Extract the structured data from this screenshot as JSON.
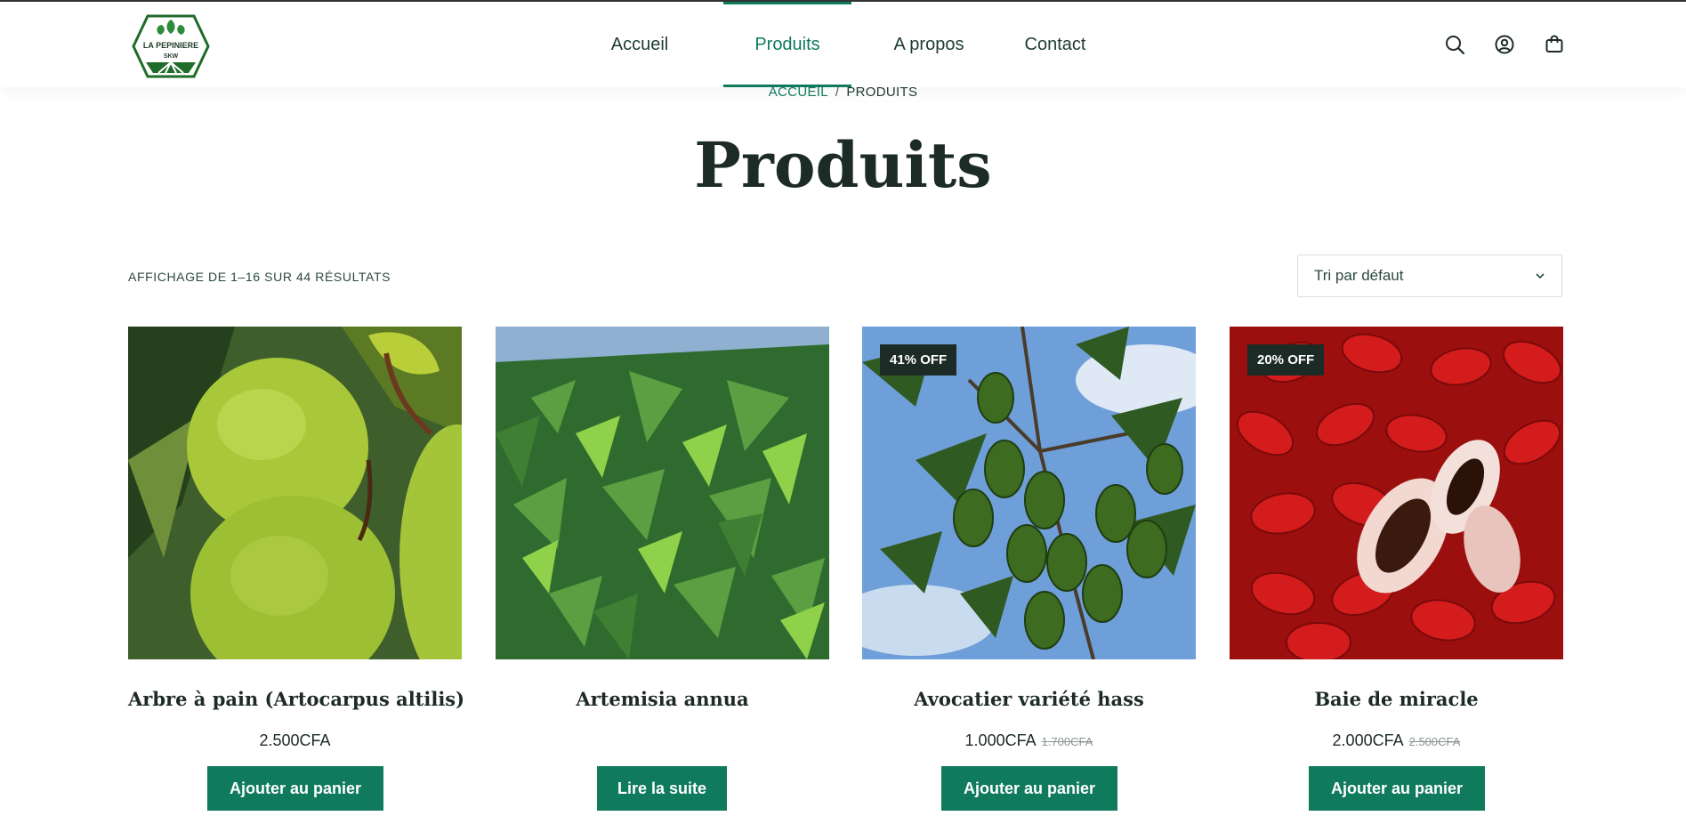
{
  "colors": {
    "accent": "#0f7a5c",
    "text_dark": "#1d2b27",
    "badge_bg": "#1d2b27"
  },
  "logo": {
    "line1": "LA PEPINIERE",
    "line2": "SKW"
  },
  "nav": {
    "items": [
      {
        "label": "Accueil"
      },
      {
        "label": "Produits",
        "active": true
      },
      {
        "label": "A propos"
      },
      {
        "label": "Contact"
      }
    ]
  },
  "header_icons": [
    "search-icon",
    "account-icon",
    "cart-icon"
  ],
  "breadcrumb": {
    "home": "ACCUEIL",
    "separator": "/",
    "current": "PRODUITS"
  },
  "page_title": "Produits",
  "result_count": "AFFICHAGE DE 1–16 SUR 44 RÉSULTATS",
  "sort": {
    "selected": "Tri par défaut"
  },
  "products": [
    {
      "name": "Arbre à pain (Artocarpus altilis)",
      "price": "2.500CFA",
      "old_price": "",
      "badge": "",
      "button": "Ajouter au panier",
      "image": "breadfruit"
    },
    {
      "name": "Artemisia annua",
      "price": "",
      "old_price": "",
      "badge": "",
      "button": "Lire la suite",
      "image": "artemisia-leaves"
    },
    {
      "name": "Avocatier variété hass",
      "price": "1.000CFA",
      "old_price": "1.700CFA",
      "badge": "41% OFF",
      "button": "Ajouter au panier",
      "image": "avocado-tree"
    },
    {
      "name": "Baie de miracle",
      "price": "2.000CFA",
      "old_price": "2.500CFA",
      "badge": "20% OFF",
      "button": "Ajouter au panier",
      "image": "miracle-berries"
    }
  ]
}
